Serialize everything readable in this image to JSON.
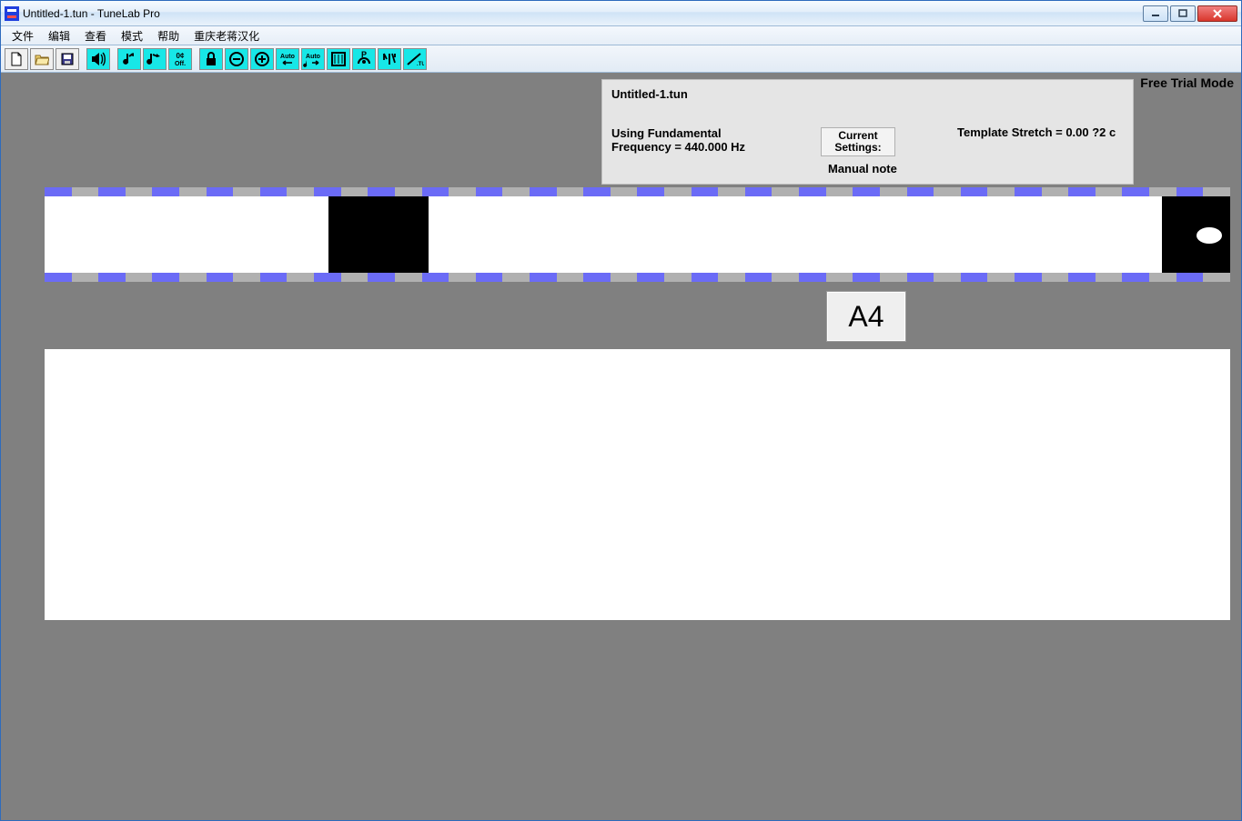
{
  "title": "Untitled-1.tun - TuneLab Pro",
  "menu": [
    "文件",
    "编辑",
    "查看",
    "模式",
    "帮助",
    "重庆老蒋汉化"
  ],
  "toolbar": {
    "items": [
      {
        "name": "new-file-icon",
        "cyan": false
      },
      {
        "name": "open-file-icon",
        "cyan": false
      },
      {
        "name": "save-file-icon",
        "cyan": false
      },
      {
        "name": "sep"
      },
      {
        "name": "speaker-icon",
        "cyan": true
      },
      {
        "name": "sep"
      },
      {
        "name": "note-prev-icon",
        "cyan": true
      },
      {
        "name": "note-next-icon",
        "cyan": true
      },
      {
        "name": "offset-off-icon",
        "cyan": true
      },
      {
        "name": "sep"
      },
      {
        "name": "lock-icon",
        "cyan": true
      },
      {
        "name": "zoom-out-icon",
        "cyan": true
      },
      {
        "name": "zoom-in-icon",
        "cyan": true
      },
      {
        "name": "auto-left-icon",
        "cyan": true
      },
      {
        "name": "auto-right-icon",
        "cyan": true
      },
      {
        "name": "measure-icon",
        "cyan": true
      },
      {
        "name": "record-icon",
        "cyan": true
      },
      {
        "name": "tuning-curve-icon",
        "cyan": true
      },
      {
        "name": "tun-file-icon",
        "cyan": true
      }
    ]
  },
  "trial": "Free Trial Mode",
  "info": {
    "filename": "Untitled-1.tun",
    "using": "Using Fundamental",
    "freq": "Frequency = 440.000 Hz",
    "currentSettings": "Current Settings:",
    "manual": "Manual note",
    "template": "Template Stretch = 0.00 ?2 c"
  },
  "note": "A4"
}
